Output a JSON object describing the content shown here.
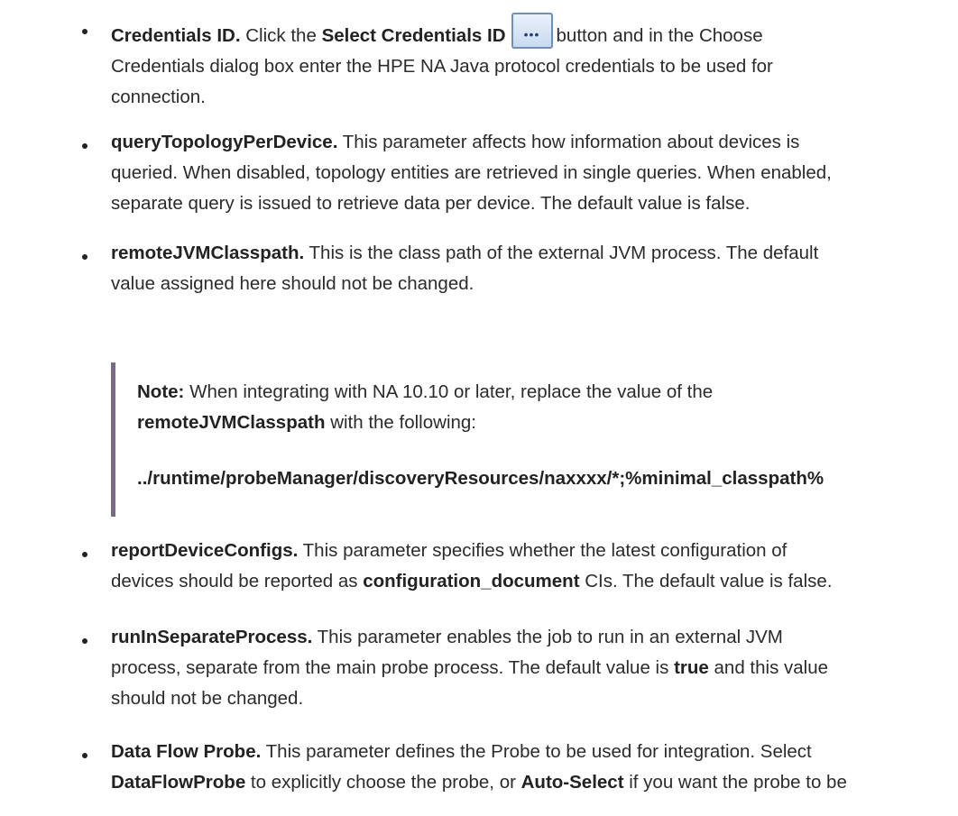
{
  "bullets": [
    {
      "lead": "Credentials ID.",
      "t1": "Click the",
      "b1": "Select Credentials ID",
      "icon": "ellipsis-button-icon",
      "t2": "button and in the Choose",
      "line2": "Credentials dialog box enter the HPE NA Java protocol credentials to be used for",
      "line3": "connection."
    },
    {
      "lead": "queryTopologyPerDevice.",
      "t1": "This parameter affects how information about devices is",
      "line2": "queried. When disabled, topology entities are retrieved in single queries. When enabled,",
      "line3": "separate query is issued to retrieve data per device. The default value is false."
    },
    {
      "lead": "remoteJVMClasspath.",
      "t1": "This is the class path of the external JVM process. The default",
      "line2": "value assigned here should not be changed."
    }
  ],
  "note": {
    "label": "Note:",
    "t1": "When integrating with NA 10.10 or later, replace the value of the",
    "b1": "remoteJVMClasspath",
    "t2": "with the following:",
    "path": "../runtime/probeManager/discoveryResources/naxxxx/*;%minimal_classpath%"
  },
  "bullets2": [
    {
      "lead": "reportDeviceConfigs.",
      "t1": "This parameter specifies whether the latest configuration of",
      "l2a": "devices should be reported as",
      "l2b": "configuration_document",
      "l2c": "CIs. The default value is false."
    },
    {
      "lead": "runInSeparateProcess.",
      "t1": "This parameter enables the job to run in an external JVM",
      "l2a": "process, separate from the main probe process. The default value is",
      "l2b": "true",
      "l2c": "and this value",
      "line3": "should not be changed."
    },
    {
      "lead": "Data Flow Probe.",
      "t1": "This parameter defines the Probe to be used for integration. Select",
      "l2a": "DataFlowProbe",
      "l2b": "to explicitly choose the probe, or",
      "l2c": "Auto-Select",
      "l2d": "if you want the probe to be"
    }
  ]
}
